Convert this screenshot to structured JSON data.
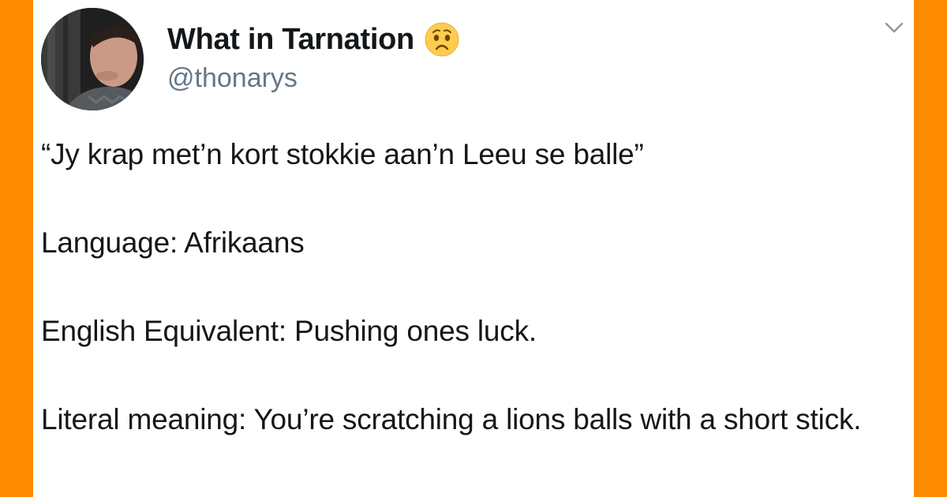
{
  "colors": {
    "frame": "#ff8c00",
    "card": "#ffffff",
    "name": "#14171a",
    "handle": "#657786",
    "caret": "#8899a6"
  },
  "tweet": {
    "display_name": "What in Tarnation",
    "emoji": "worried-face-emoji",
    "handle": "@thonarys",
    "lines": [
      "“Jy krap met’n kort stokkie aan’n Leeu se balle”",
      "Language: Afrikaans",
      "English Equivalent: Pushing ones luck.",
      "Literal meaning: You’re scratching a lions balls with a short stick."
    ]
  },
  "icons": {
    "menu": "chevron-down-icon",
    "avatar": "profile-avatar"
  }
}
